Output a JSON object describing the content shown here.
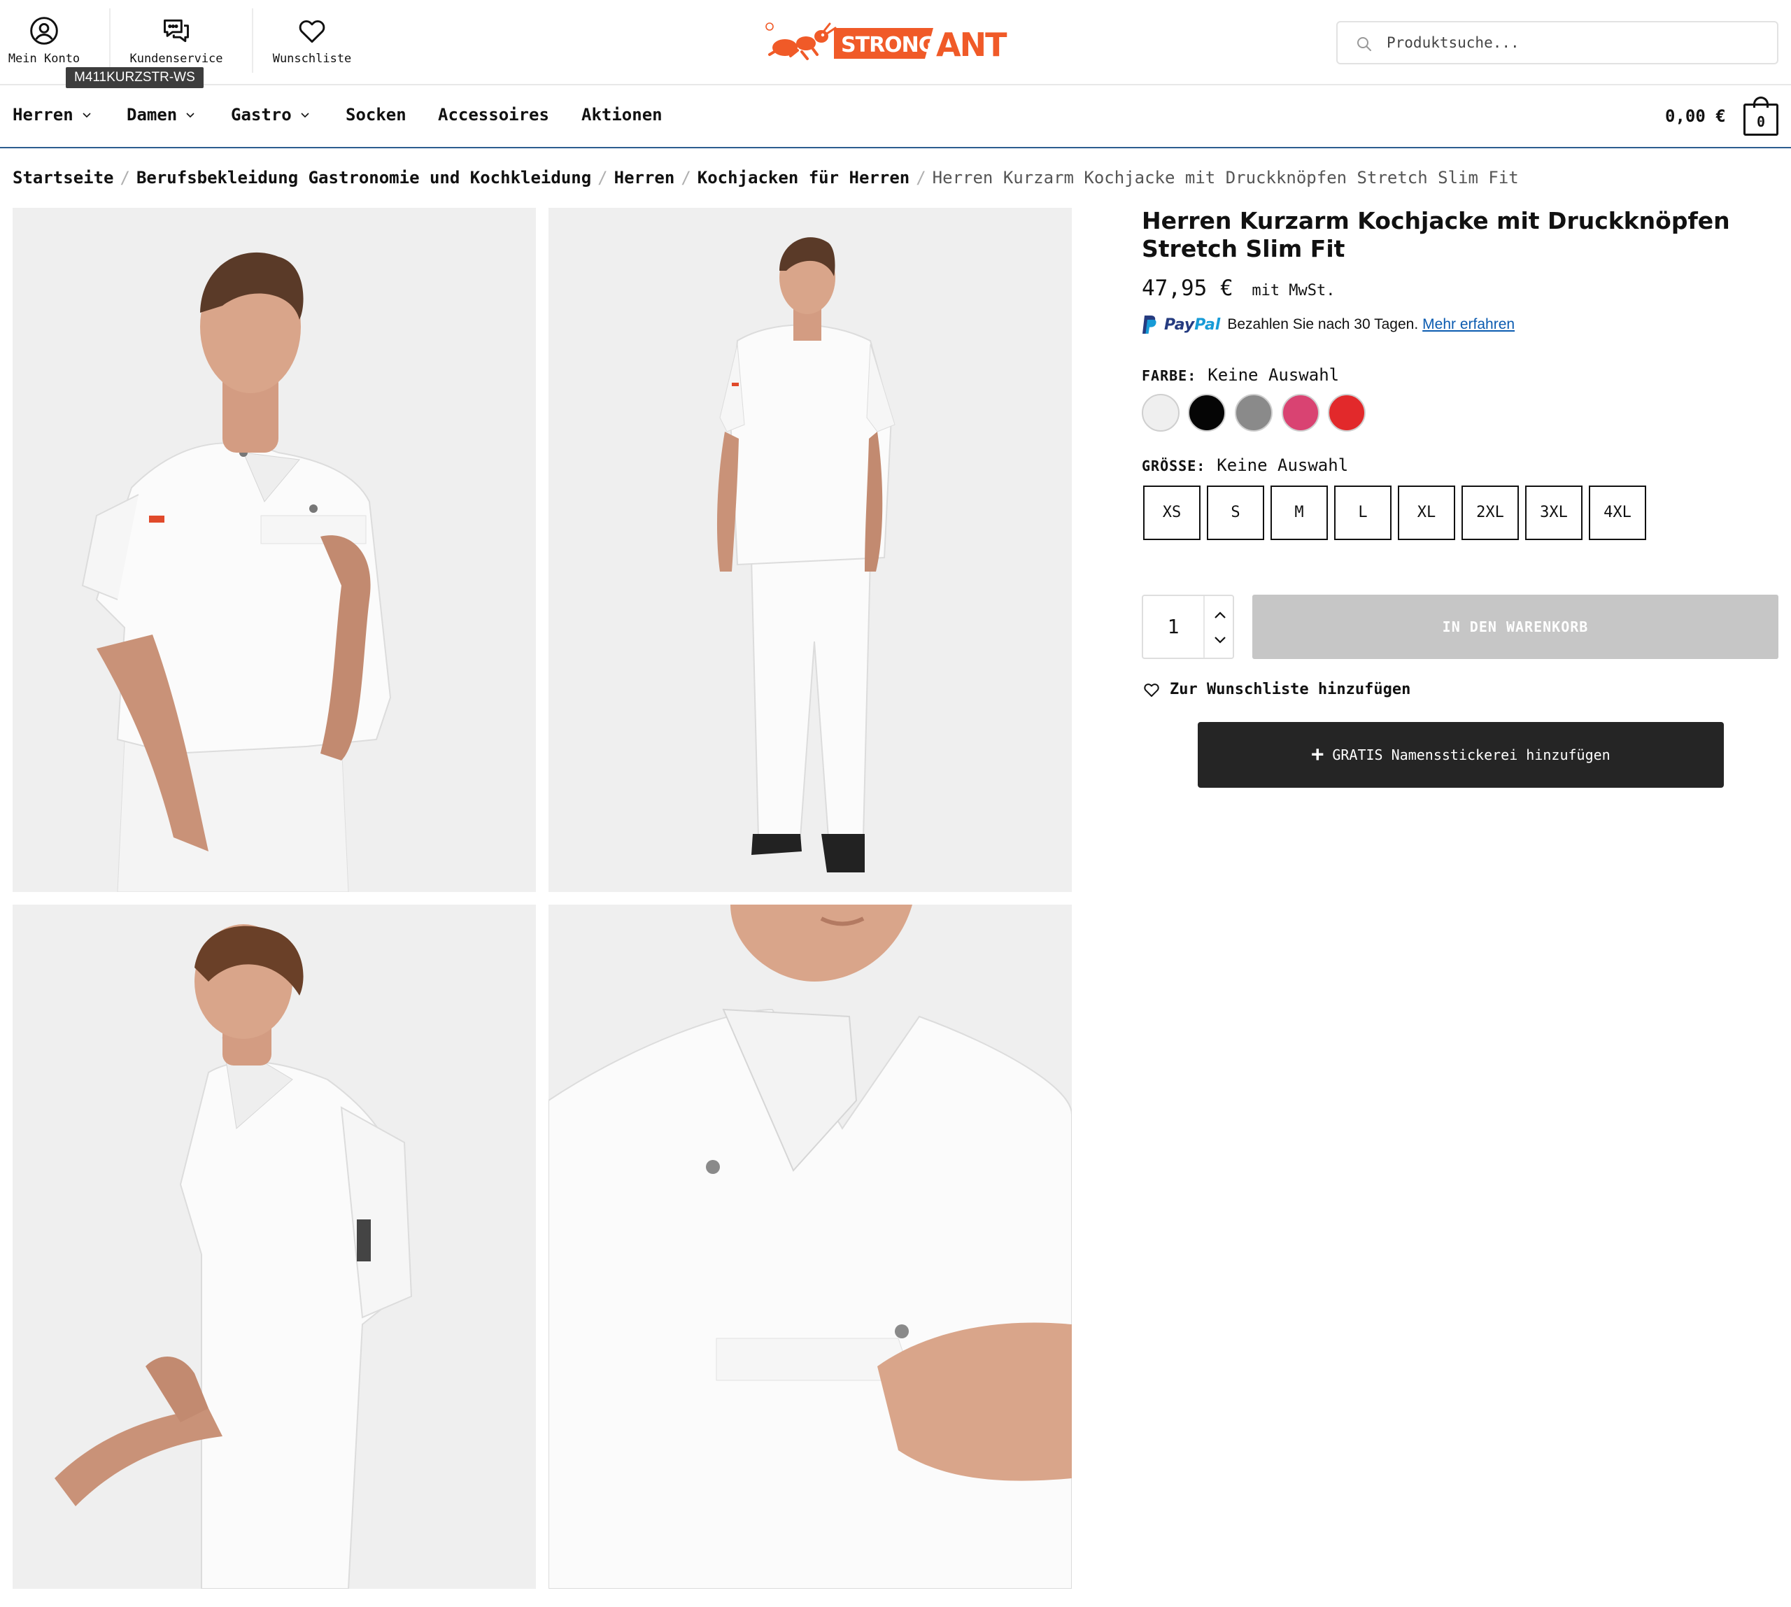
{
  "header": {
    "account_label": "Mein Konto",
    "service_label": "Kundenservice",
    "wishlist_label": "Wunschliste",
    "sku_tooltip": "M411KURZSTR-WS",
    "logo": {
      "text_left": "STRONG",
      "text_right": "ANT",
      "brand_color": "#f05a28"
    },
    "search": {
      "placeholder": "Produktsuche..."
    }
  },
  "nav": {
    "items": [
      {
        "label": "Herren",
        "has_dropdown": true
      },
      {
        "label": "Damen",
        "has_dropdown": true
      },
      {
        "label": "Gastro",
        "has_dropdown": true
      },
      {
        "label": "Socken",
        "has_dropdown": false
      },
      {
        "label": "Accessoires",
        "has_dropdown": false
      },
      {
        "label": "Aktionen",
        "has_dropdown": false
      }
    ],
    "cart_total": "0,00 €",
    "cart_count": "0",
    "accent_color": "#2c5d8f"
  },
  "breadcrumb": [
    "Startseite",
    "Berufsbekleidung Gastronomie und Kochkleidung",
    "Herren",
    "Kochjacken für Herren",
    "Herren Kurzarm Kochjacke mit Druckknöpfen Stretch Slim Fit"
  ],
  "breadcrumb_separator": "/",
  "gallery": [
    {
      "name": "photo-chef-jacket-front"
    },
    {
      "name": "photo-chef-jacket-full-body"
    },
    {
      "name": "photo-chef-jacket-side"
    },
    {
      "name": "photo-chef-jacket-detail"
    }
  ],
  "product": {
    "title": "Herren Kurzarm Kochjacke mit Druckknöpfen Stretch Slim Fit",
    "price": "47,95 €",
    "vat_note": "mit MwSt.",
    "paypal": {
      "brand_pay": "Pay",
      "brand_pal": "Pal",
      "text": "Bezahlen Sie nach 30 Tagen.",
      "link": "Mehr erfahren"
    },
    "color_label": "FARBE:",
    "color_value": "Keine Auswahl",
    "colors": [
      "#efefef",
      "#050505",
      "#8a8a8a",
      "#d94372",
      "#e2292b"
    ],
    "size_label": "GRÖSSE:",
    "size_value": "Keine Auswahl",
    "sizes": [
      "XS",
      "S",
      "M",
      "L",
      "XL",
      "2XL",
      "3XL",
      "4XL"
    ],
    "quantity": "1",
    "add_to_cart": "IN DEN WARENKORB",
    "wishlist_link": "Zur Wunschliste hinzufügen",
    "embroidery_button": "GRATIS Namensstickerei hinzufügen"
  }
}
